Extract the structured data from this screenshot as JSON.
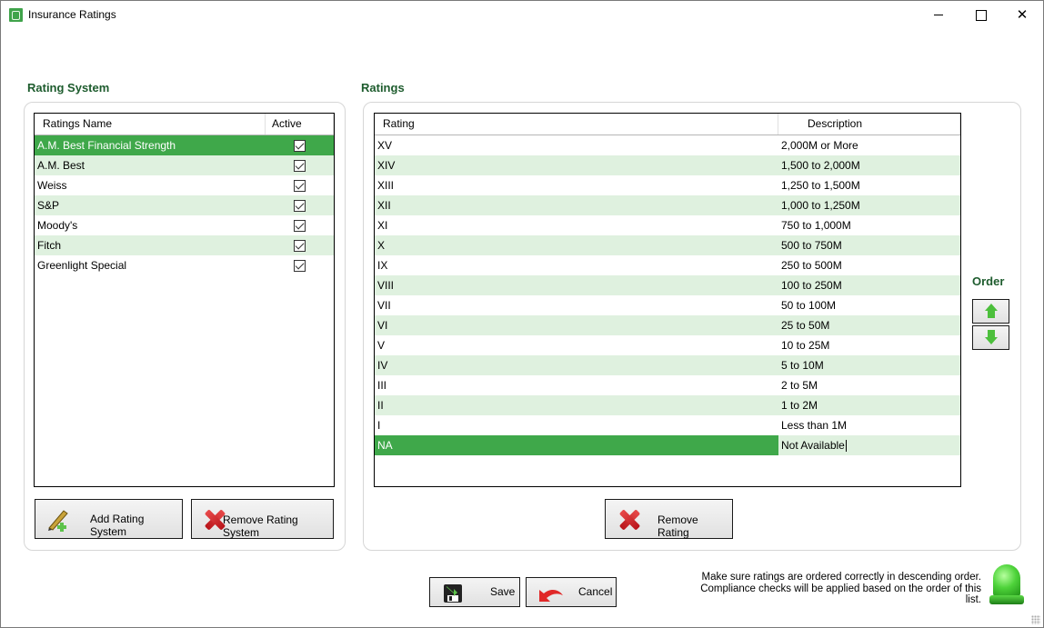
{
  "window": {
    "title": "Insurance Ratings",
    "controls": {
      "minimize": "minimize",
      "maximize": "maximize",
      "close": "close"
    }
  },
  "rating_system": {
    "section_label": "Rating System",
    "columns": [
      "Ratings Name",
      "Active"
    ],
    "rows": [
      {
        "name": "A.M. Best Financial Strength",
        "active": true,
        "selected": true
      },
      {
        "name": "A.M. Best",
        "active": true,
        "selected": false
      },
      {
        "name": "Weiss",
        "active": true,
        "selected": false
      },
      {
        "name": "S&P",
        "active": true,
        "selected": false
      },
      {
        "name": "Moody's",
        "active": true,
        "selected": false
      },
      {
        "name": "Fitch",
        "active": true,
        "selected": false
      },
      {
        "name": "Greenlight Special",
        "active": true,
        "selected": false
      }
    ],
    "add_button": "Add Rating System",
    "remove_button": "Remove Rating System"
  },
  "ratings": {
    "section_label": "Ratings",
    "columns": [
      "Rating",
      "Description"
    ],
    "rows": [
      {
        "rating": "XV",
        "description": "2,000M or More"
      },
      {
        "rating": "XIV",
        "description": "1,500 to 2,000M"
      },
      {
        "rating": "XIII",
        "description": "1,250 to 1,500M"
      },
      {
        "rating": "XII",
        "description": "1,000 to 1,250M"
      },
      {
        "rating": "XI",
        "description": "750 to 1,000M"
      },
      {
        "rating": "X",
        "description": "500 to 750M"
      },
      {
        "rating": "IX",
        "description": "250 to 500M"
      },
      {
        "rating": "VIII",
        "description": "100 to 250M"
      },
      {
        "rating": "VII",
        "description": "50 to 100M"
      },
      {
        "rating": "VI",
        "description": "25 to 50M"
      },
      {
        "rating": "V",
        "description": "10 to 25M"
      },
      {
        "rating": "IV",
        "description": "5 to 10M"
      },
      {
        "rating": "III",
        "description": "2 to 5M"
      },
      {
        "rating": "II",
        "description": "1 to 2M"
      },
      {
        "rating": "I",
        "description": "Less than 1M"
      },
      {
        "rating": "NA",
        "description": "Not Available",
        "selected": true,
        "editing": true
      }
    ],
    "remove_button": "Remove Rating",
    "order_label": "Order"
  },
  "footer": {
    "save_button": "Save",
    "cancel_button": "Cancel",
    "notice": "Make sure ratings are ordered correctly in descending order. Compliance checks will be applied based on the order of this list."
  },
  "colors": {
    "accent_green": "#3fa84a",
    "alt_row": "#dff1df",
    "section_label": "#1e5c2e"
  }
}
